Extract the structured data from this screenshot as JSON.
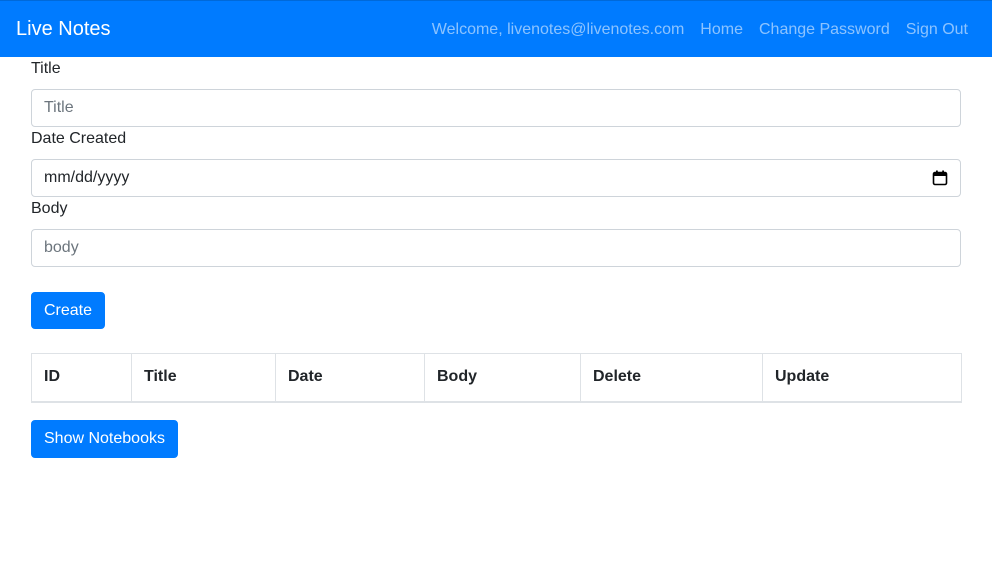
{
  "navbar": {
    "brand": "Live Notes",
    "welcome": "Welcome, livenotes@livenotes.com",
    "links": [
      "Home",
      "Change Password",
      "Sign Out"
    ],
    "color": "#007bff"
  },
  "form": {
    "title_label": "Title",
    "title_placeholder": "Title",
    "date_label": "Date Created",
    "date_placeholder": "mm/dd/yyyy",
    "body_label": "Body",
    "body_placeholder": "body",
    "create_button": "Create"
  },
  "table": {
    "headers": [
      "ID",
      "Title",
      "Date",
      "Body",
      "Delete",
      "Update"
    ]
  },
  "show_notebooks_button": "Show Notebooks",
  "icons": {
    "calendar": "calendar-icon"
  }
}
